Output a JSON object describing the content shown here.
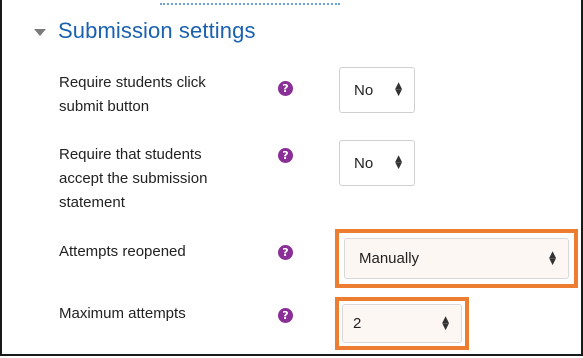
{
  "section": {
    "title": "Submission settings",
    "icon": "collapse-caret-icon"
  },
  "fields": [
    {
      "label_lines": [
        "Require students click",
        "submit button"
      ],
      "value": "No"
    },
    {
      "label_lines": [
        "Require that students",
        "accept the submission",
        "statement"
      ],
      "value": "No"
    },
    {
      "label_lines": [
        "Attempts reopened"
      ],
      "value": "Manually"
    },
    {
      "label_lines": [
        "Maximum attempts"
      ],
      "value": "2"
    }
  ],
  "help_glyph": "?",
  "select_arrows": {
    "up": "▲",
    "down": "▼"
  },
  "colors": {
    "title": "#1a61b0",
    "help_icon": "#8a2f98",
    "highlight": "#ed7d31",
    "frame": "#1a1a1a"
  }
}
